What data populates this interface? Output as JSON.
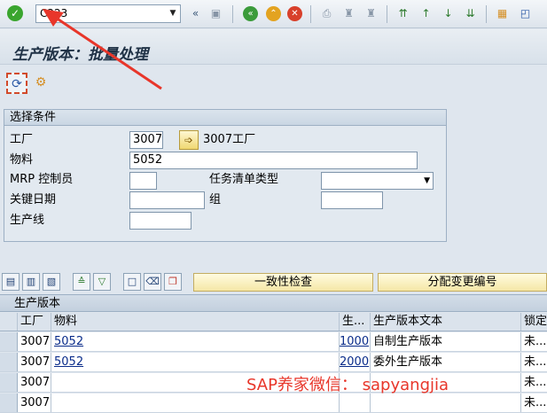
{
  "toolbar": {
    "command_value": "C223",
    "icons": [
      "check-icon",
      "save-icon",
      "back-icon",
      "exit-icon",
      "cancel-icon",
      "print-icon",
      "find-icon",
      "find-next-icon",
      "first-page-icon",
      "prev-page-icon",
      "next-page-icon",
      "last-page-icon",
      "new-session-icon",
      "shortcut-icon"
    ]
  },
  "title": "生产版本：批量处理",
  "selection": {
    "group_title": "选择条件",
    "plant_label": "工厂",
    "plant_value": "3007",
    "plant_text": "3007工厂",
    "material_label": "物料",
    "material_value": "5052",
    "mrp_label": "MRP 控制员",
    "mrp_value": "",
    "tasklist_label": "任务清单类型",
    "tasklist_value": "",
    "keydate_label": "关键日期",
    "keydate_value": "",
    "group_label": "组",
    "group_value": "",
    "line_label": "生产线",
    "line_value": ""
  },
  "table_toolbar": {
    "consistency_label": "一致性检查",
    "assign_label": "分配变更编号"
  },
  "table": {
    "title": "生产版本",
    "headers": {
      "plant": "工厂",
      "material": "物料",
      "version": "生...",
      "text": "生产版本文本",
      "lock": "锁定"
    },
    "rows": [
      {
        "plant": "3007",
        "material": "5052",
        "version": "1000",
        "text": "自制生产版本",
        "lock": "未..."
      },
      {
        "plant": "3007",
        "material": "5052",
        "version": "2000",
        "text": "委外生产版本",
        "lock": "未..."
      },
      {
        "plant": "3007",
        "material": "",
        "version": "",
        "text": "",
        "lock": "未..."
      },
      {
        "plant": "3007",
        "material": "",
        "version": "",
        "text": "",
        "lock": "未..."
      }
    ]
  },
  "watermark": "SAP养家微信：  sapyangjia",
  "colors": {
    "accent_red": "#e8362a",
    "link_blue": "#0a2c8a",
    "ok_green": "#3aa52e"
  }
}
